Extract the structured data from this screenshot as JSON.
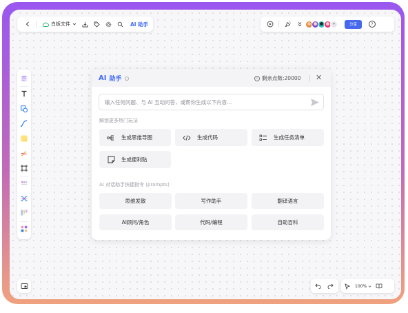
{
  "toolbar_left": {
    "file_name": "白板文件",
    "ai_tab": "AI 助手"
  },
  "toolbar_right": {
    "extra_avatars": "+",
    "share_label": "分享",
    "help": "?"
  },
  "ai_panel": {
    "title_ai": "AI",
    "title_zh": "助手",
    "points_label": "剩余点数:20000",
    "close": "✕",
    "input_placeholder": "输入任何问题、与 AI 互动问答，或帮你生成以下内容...",
    "section_features": "解锁更多热门玩法",
    "features": [
      {
        "label": "生成思维导图",
        "icon": "mindmap-icon"
      },
      {
        "label": "生成代码",
        "icon": "code-icon"
      },
      {
        "label": "生成任务清单",
        "icon": "checklist-icon"
      },
      {
        "label": "生成便利贴",
        "icon": "sticky-note-icon"
      }
    ],
    "section_prompts": "AI 对话助手快捷指令 (prompts)",
    "prompts": [
      "思维发散",
      "写作助手",
      "翻译语言",
      "AI顾问/角色",
      "代码/编程",
      "自助百科"
    ]
  },
  "bottom_right": {
    "zoom": "100%"
  },
  "colors": {
    "accent": "#4568ee",
    "ai_blue": "#3f6bf4",
    "frame_top": "#9a57f0",
    "frame_bottom": "#f0a27e"
  }
}
